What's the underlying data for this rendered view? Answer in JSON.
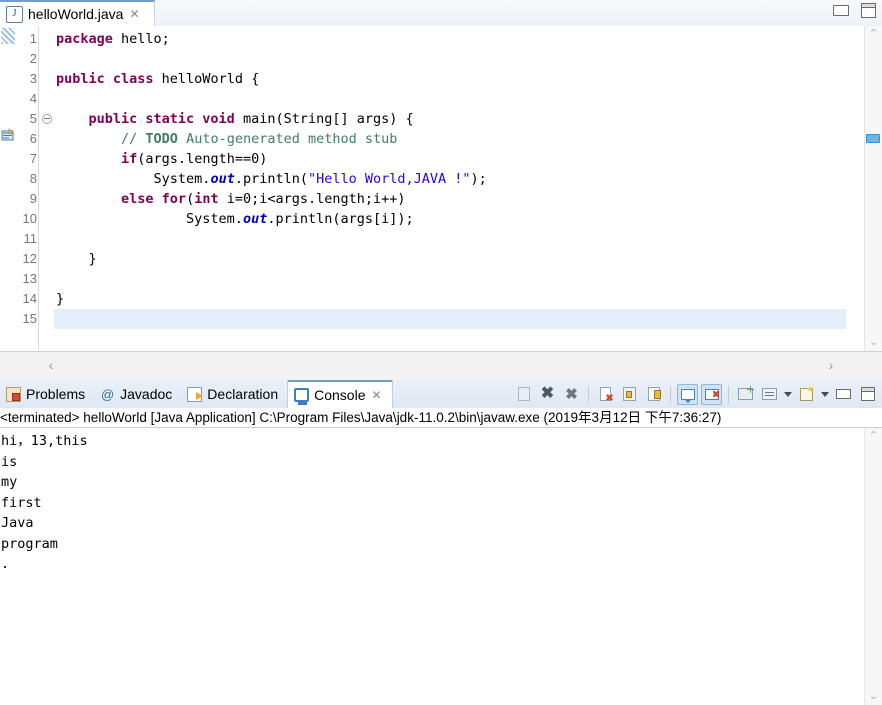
{
  "editor": {
    "tab": {
      "label": "helloWorld.java",
      "icon": "java-file-icon",
      "close_label": "✕"
    },
    "window_controls": {
      "minimize": "minimize-icon",
      "maximize": "maximize-icon"
    },
    "line_numbers": [
      "1",
      "2",
      "3",
      "4",
      "5",
      "6",
      "7",
      "8",
      "9",
      "10",
      "11",
      "12",
      "13",
      "14",
      "15"
    ],
    "current_line": 15,
    "fold_markers": [
      5
    ],
    "task_marker_line": 6,
    "code_lines": [
      [
        {
          "t": "package ",
          "c": "kw"
        },
        {
          "t": "hello;",
          "c": "plain"
        }
      ],
      [],
      [
        {
          "t": "public class ",
          "c": "kw"
        },
        {
          "t": "helloWorld {",
          "c": "plain"
        }
      ],
      [],
      [
        {
          "t": "    ",
          "c": "plain"
        },
        {
          "t": "public static void ",
          "c": "kw"
        },
        {
          "t": "main(String[] args) {",
          "c": "plain"
        }
      ],
      [
        {
          "t": "        ",
          "c": "plain"
        },
        {
          "t": "// ",
          "c": "cmt"
        },
        {
          "t": "TODO",
          "c": "todo"
        },
        {
          "t": " Auto-generated method stub",
          "c": "cmt"
        }
      ],
      [
        {
          "t": "        ",
          "c": "plain"
        },
        {
          "t": "if",
          "c": "kw"
        },
        {
          "t": "(args.length==0)",
          "c": "plain"
        }
      ],
      [
        {
          "t": "            System.",
          "c": "plain"
        },
        {
          "t": "out",
          "c": "stat"
        },
        {
          "t": ".println(",
          "c": "plain"
        },
        {
          "t": "\"Hello World,JAVA !\"",
          "c": "str"
        },
        {
          "t": ");",
          "c": "plain"
        }
      ],
      [
        {
          "t": "        ",
          "c": "plain"
        },
        {
          "t": "else for",
          "c": "kw"
        },
        {
          "t": "(",
          "c": "plain"
        },
        {
          "t": "int",
          "c": "kw"
        },
        {
          "t": " i=0;i<args.length;i++)",
          "c": "plain"
        }
      ],
      [
        {
          "t": "                System.",
          "c": "plain"
        },
        {
          "t": "out",
          "c": "stat"
        },
        {
          "t": ".println(args[i]);",
          "c": "plain"
        }
      ],
      [],
      [
        {
          "t": "    }",
          "c": "plain"
        }
      ],
      [],
      [
        {
          "t": "}",
          "c": "plain"
        }
      ],
      []
    ],
    "scroll_up_glyph": "⌃",
    "scroll_down_glyph": "⌄",
    "hscroll_left_glyph": "‹",
    "hscroll_right_glyph": "›"
  },
  "console_panel": {
    "tabs": [
      {
        "label": "Problems",
        "icon": "problems-icon",
        "active": false
      },
      {
        "label": "Javadoc",
        "icon": "javadoc-icon",
        "active": false
      },
      {
        "label": "Declaration",
        "icon": "declaration-icon",
        "active": false
      },
      {
        "label": "Console",
        "icon": "console-icon",
        "active": true,
        "close_label": "✕"
      }
    ],
    "toolbar": [
      {
        "name": "terminate-all-button",
        "glyph": "g-page",
        "toggled": false
      },
      {
        "name": "remove-launch-button",
        "glyph": "g-x",
        "toggled": false
      },
      {
        "name": "remove-all-terminated-button",
        "glyph": "g-xx",
        "toggled": false
      },
      {
        "name": "clear-console-button",
        "glyph": "g-doc",
        "toggled": false
      },
      {
        "name": "scroll-lock-button",
        "glyph": "g-lock",
        "toggled": false
      },
      {
        "name": "word-wrap-button",
        "glyph": "g-pin",
        "toggled": false
      },
      {
        "name": "show-console-on-output-button",
        "glyph": "g-bubble",
        "toggled": true
      },
      {
        "name": "show-console-on-error-button",
        "glyph": "g-bubble-red",
        "toggled": true
      },
      {
        "name": "pin-console-button",
        "glyph": "g-screen-green",
        "toggled": false
      },
      {
        "name": "display-selected-console-button",
        "glyph": "g-monitor",
        "toggled": false
      },
      {
        "name": "open-console-button",
        "glyph": "g-newcon",
        "toggled": false
      },
      {
        "name": "minimize-panel-button",
        "glyph": "g-min",
        "toggled": false
      },
      {
        "name": "maximize-panel-button",
        "glyph": "g-max",
        "toggled": false
      }
    ],
    "header_text": "<terminated> helloWorld [Java Application] C:\\Program Files\\Java\\jdk-11.0.2\\bin\\javaw.exe (2019年3月12日 下午7:36:27)",
    "output_lines": [
      "hi，13,this",
      "is",
      "my",
      "first",
      "Java",
      "program",
      "."
    ],
    "scroll_up_glyph": "⌃",
    "scroll_down_glyph": "⌄"
  },
  "colors": {
    "accent": "#6a9fd4",
    "keyword": "#7f0055",
    "string": "#2a00ff",
    "comment": "#3f7f5f",
    "static_field": "#0000c0",
    "current_line_bg": "#e4eefb"
  }
}
